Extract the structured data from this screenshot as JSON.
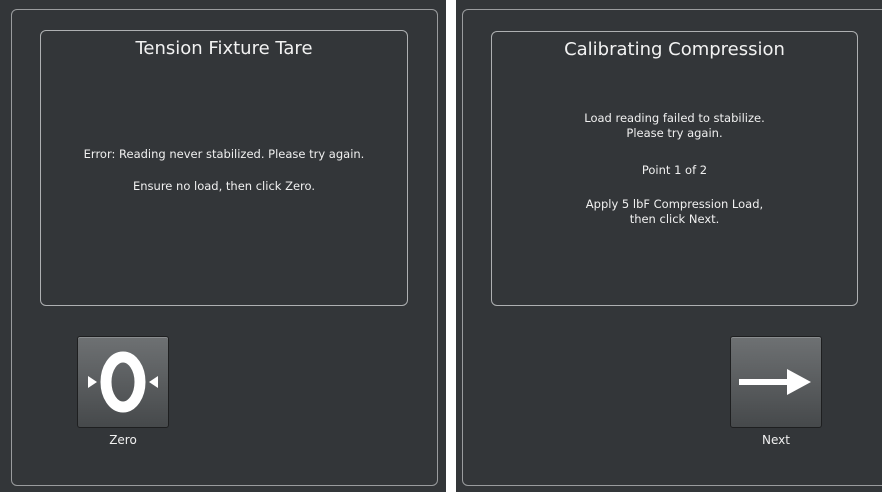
{
  "tare_panel": {
    "title": "Tension Fixture Tare",
    "message_1": "Error: Reading never stabilized. Please try again.",
    "message_2": "Ensure no load, then click Zero.",
    "zero_button_label": "Zero",
    "zero_icon": "zero-icon"
  },
  "calibration_panel": {
    "title": "Calibrating Compression",
    "message_1a": "Load reading failed to stabilize.",
    "message_1b": "Please try again.",
    "message_2": "Point 1 of 2",
    "message_3a": "Apply 5 lbF Compression Load,",
    "message_3b": "then click Next.",
    "next_button_label": "Next",
    "next_icon": "arrow-right-icon"
  },
  "colors": {
    "panel_background": "#333639",
    "border": "#aeb0b2",
    "text": "#ffffff",
    "button_top": "#6e7173",
    "button_bottom": "#46494b"
  }
}
